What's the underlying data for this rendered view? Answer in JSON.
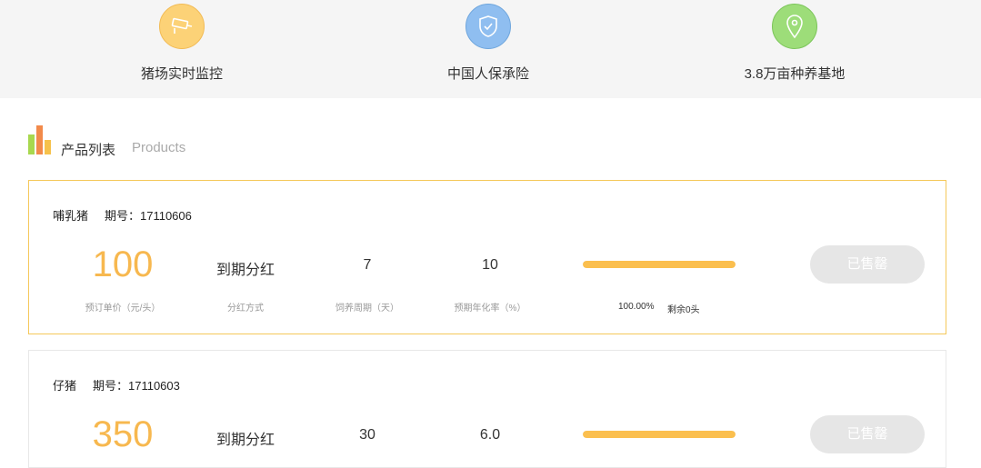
{
  "features": [
    {
      "label": "猪场实时监控",
      "icon": "camera-icon",
      "color": "#fcd277"
    },
    {
      "label": "中国人保承险",
      "icon": "shield-icon",
      "color": "#8fbef0"
    },
    {
      "label": "3.8万亩种养基地",
      "icon": "location-pin-icon",
      "color": "#9ddd79"
    }
  ],
  "section": {
    "title": "产品列表",
    "subtitle": "Products"
  },
  "products": [
    {
      "name": "哺乳猪",
      "period_label": "期号：17110606",
      "price": "100",
      "price_caption": "预订单价（元/头）",
      "dividend": "到期分红",
      "dividend_caption": "分红方式",
      "cycle": "7",
      "cycle_caption": "饲养周期（天）",
      "rate": "10",
      "rate_caption": "预期年化率（%）",
      "progress": 1.0,
      "progress_text": "100.00%",
      "remain_text": "剩余0头",
      "button": "已售罄"
    },
    {
      "name": "仔猪",
      "period_label": "期号：17110603",
      "price": "350",
      "dividend": "到期分红",
      "cycle": "30",
      "rate": "6.0",
      "progress": 1.0,
      "button": "已售罄"
    }
  ],
  "colors": {
    "accent": "#f7b84f",
    "active_border": "#f5c85a",
    "bar_fill": "#fbbf4e"
  }
}
